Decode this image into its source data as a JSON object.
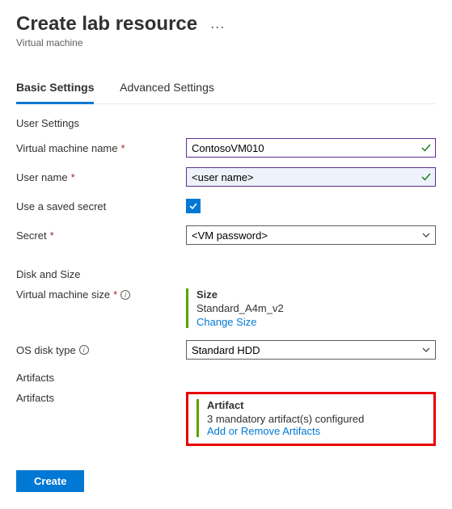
{
  "header": {
    "title": "Create lab resource",
    "subtitle": "Virtual machine"
  },
  "tabs": {
    "basic": "Basic Settings",
    "advanced": "Advanced Settings"
  },
  "sections": {
    "user_settings": "User Settings",
    "disk_size": "Disk and Size",
    "artifacts": "Artifacts"
  },
  "labels": {
    "vm_name": "Virtual machine name",
    "user_name": "User name",
    "saved_secret": "Use a saved secret",
    "secret": "Secret",
    "vm_size": "Virtual machine size",
    "os_disk": "OS disk type",
    "artifacts": "Artifacts"
  },
  "values": {
    "vm_name": "ContosoVM010",
    "user_name": "<user name>",
    "secret": "<VM password>",
    "os_disk": "Standard HDD"
  },
  "size_block": {
    "title": "Size",
    "value": "Standard_A4m_v2",
    "link": "Change Size"
  },
  "artifact_block": {
    "title": "Artifact",
    "status": "3 mandatory artifact(s) configured",
    "link": "Add or Remove Artifacts"
  },
  "buttons": {
    "create": "Create"
  }
}
